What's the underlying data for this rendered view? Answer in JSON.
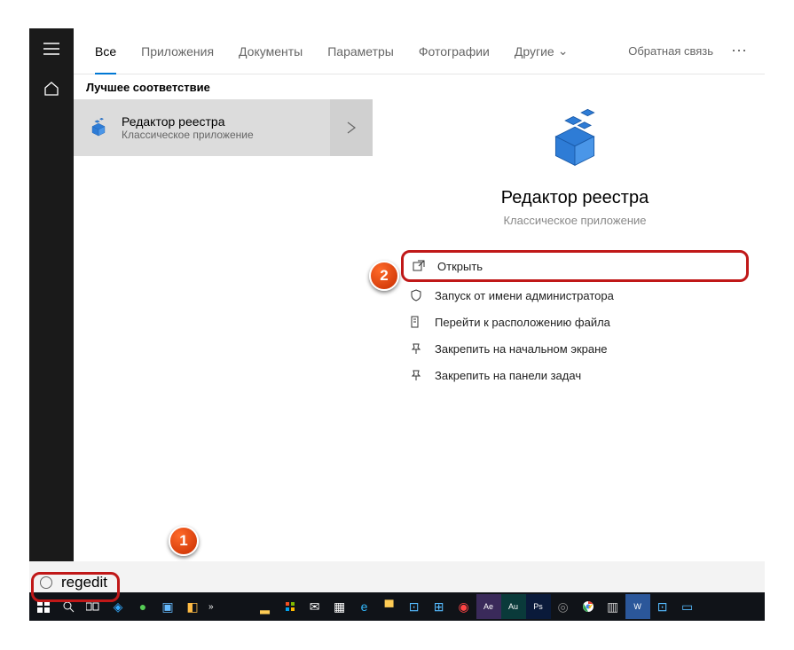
{
  "header": {
    "tabs": [
      "Все",
      "Приложения",
      "Документы",
      "Параметры",
      "Фотографии",
      "Другие"
    ],
    "feedback": "Обратная связь"
  },
  "section_label": "Лучшее соответствие",
  "result": {
    "title": "Редактор реестра",
    "subtitle": "Классическое приложение"
  },
  "detail": {
    "title": "Редактор реестра",
    "subtitle": "Классическое приложение",
    "actions": [
      {
        "id": "open",
        "label": "Открыть",
        "icon": "open"
      },
      {
        "id": "admin",
        "label": "Запуск от имени администратора",
        "icon": "shield"
      },
      {
        "id": "location",
        "label": "Перейти к расположению файла",
        "icon": "folder"
      },
      {
        "id": "pin_start",
        "label": "Закрепить на начальном экране",
        "icon": "pin"
      },
      {
        "id": "pin_task",
        "label": "Закрепить на панели задач",
        "icon": "pin"
      }
    ]
  },
  "search": {
    "value": "regedit"
  },
  "annotations": {
    "badge1": "1",
    "badge2": "2"
  },
  "taskbar_icons": [
    "start",
    "search",
    "taskview",
    "cortana",
    "utorrent",
    "app1",
    "app2",
    "app3",
    "explorer",
    "store",
    "mail",
    "calendar",
    "edge",
    "folder",
    "img1",
    "img2",
    "alarm",
    "ae",
    "au",
    "ps",
    "obs",
    "chrome",
    "word",
    "app4",
    "app5",
    "app6"
  ]
}
